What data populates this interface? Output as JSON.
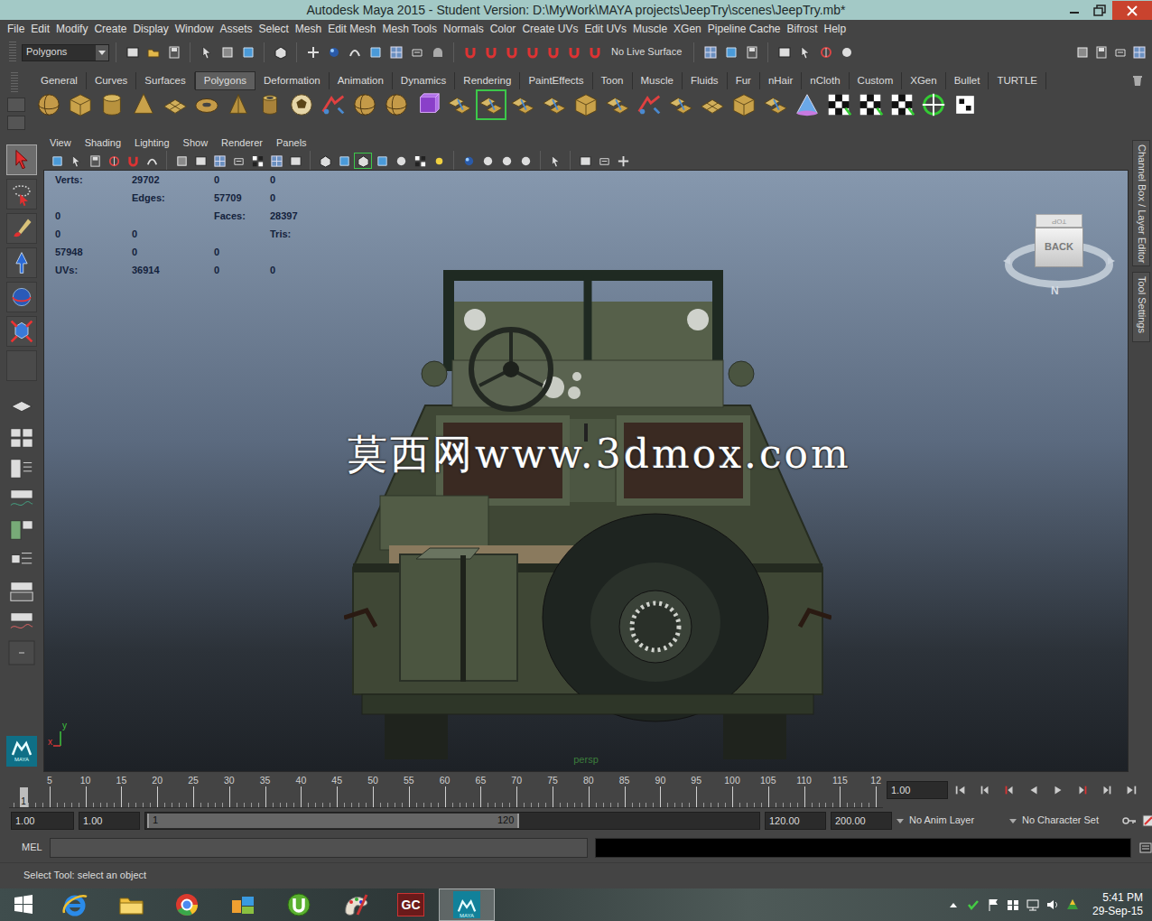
{
  "window": {
    "title": "Autodesk Maya 2015 - Student Version: D:\\MyWork\\MAYA projects\\JeepTry\\scenes\\JeepTry.mb*"
  },
  "menu": [
    "File",
    "Edit",
    "Modify",
    "Create",
    "Display",
    "Window",
    "Assets",
    "Select",
    "Mesh",
    "Edit Mesh",
    "Mesh Tools",
    "Normals",
    "Color",
    "Create UVs",
    "Edit UVs",
    "Muscle",
    "XGen",
    "Pipeline Cache",
    "Bifrost",
    "Help"
  ],
  "status_line": {
    "mode": "Polygons",
    "live_surface": "No Live Surface"
  },
  "shelf": {
    "tabs": [
      {
        "label": "General",
        "selected": false
      },
      {
        "label": "Curves",
        "selected": false
      },
      {
        "label": "Surfaces",
        "selected": false
      },
      {
        "label": "Polygons",
        "selected": true
      },
      {
        "label": "Deformation",
        "selected": false
      },
      {
        "label": "Animation",
        "selected": false
      },
      {
        "label": "Dynamics",
        "selected": false
      },
      {
        "label": "Rendering",
        "selected": false
      },
      {
        "label": "PaintEffects",
        "selected": false
      },
      {
        "label": "Toon",
        "selected": false
      },
      {
        "label": "Muscle",
        "selected": false
      },
      {
        "label": "Fluids",
        "selected": false
      },
      {
        "label": "Fur",
        "selected": false
      },
      {
        "label": "nHair",
        "selected": false
      },
      {
        "label": "nCloth",
        "selected": false
      },
      {
        "label": "Custom",
        "selected": false
      },
      {
        "label": "XGen",
        "selected": false
      },
      {
        "label": "Bullet",
        "selected": false
      },
      {
        "label": "TURTLE",
        "selected": false
      }
    ],
    "icons": [
      {
        "selected": false
      },
      {
        "selected": false
      },
      {
        "selected": false
      },
      {
        "selected": false
      },
      {
        "selected": false
      },
      {
        "selected": false
      },
      {
        "selected": false
      },
      {
        "selected": false
      },
      {
        "selected": false
      },
      {
        "selected": false
      },
      {
        "selected": false
      },
      {
        "selected": false
      },
      {
        "selected": false
      },
      {
        "selected": false
      },
      {
        "selected": true
      },
      {
        "selected": false
      },
      {
        "selected": false
      },
      {
        "selected": false
      },
      {
        "selected": false
      },
      {
        "selected": false
      },
      {
        "selected": false
      },
      {
        "selected": false
      },
      {
        "selected": false
      },
      {
        "selected": false
      },
      {
        "selected": false
      },
      {
        "selected": false
      },
      {
        "selected": false
      },
      {
        "selected": false
      },
      {
        "selected": false
      },
      {
        "selected": false
      }
    ]
  },
  "toolbox": {
    "tools": [
      {
        "selected": true
      },
      {
        "selected": false
      },
      {
        "selected": false
      },
      {
        "selected": false
      },
      {
        "selected": false
      },
      {
        "selected": false
      },
      {
        "selected": false
      }
    ],
    "logo": "MAYA"
  },
  "panel": {
    "menu": [
      "View",
      "Shading",
      "Lighting",
      "Show",
      "Renderer",
      "Panels"
    ],
    "toolbar": [
      {
        "selected": false
      },
      {
        "selected": false
      },
      {
        "selected": false
      },
      {
        "selected": false
      },
      {
        "selected": false
      },
      {
        "selected": false
      },
      {
        "selected": false
      },
      {
        "selected": false
      },
      {
        "selected": false
      },
      {
        "selected": false
      },
      {
        "selected": false
      },
      {
        "selected": false
      },
      {
        "selected": false
      },
      {
        "selected": false
      },
      {
        "selected": false
      },
      {
        "selected": true
      },
      {
        "selected": false
      },
      {
        "selected": false
      },
      {
        "selected": false
      },
      {
        "selected": false
      },
      {
        "selected": false
      },
      {
        "selected": false
      },
      {
        "selected": false
      },
      {
        "selected": false
      },
      {
        "selected": false
      },
      {
        "selected": false
      },
      {
        "selected": false
      },
      {
        "selected": false
      }
    ]
  },
  "hud": [
    {
      "label": "Verts:",
      "values": [
        "29702",
        "0",
        "0"
      ]
    },
    {
      "label": "Edges:",
      "values": [
        "57709",
        "0",
        "0"
      ]
    },
    {
      "label": "Faces:",
      "values": [
        "28397",
        "0",
        "0"
      ]
    },
    {
      "label": "Tris:",
      "values": [
        "57948",
        "0",
        "0"
      ]
    },
    {
      "label": "UVs:",
      "values": [
        "36914",
        "0",
        "0"
      ]
    }
  ],
  "viewcube": {
    "top": "TOP",
    "face": "BACK",
    "compass": "N"
  },
  "viewport": {
    "watermark": "莫西网www.3dmox.com",
    "camera": "persp",
    "axes": [
      "y",
      "x"
    ]
  },
  "side_tabs": [
    "Channel Box / Layer Editor",
    "Tool Settings"
  ],
  "time_slider": {
    "ticks": [
      "5",
      "10",
      "15",
      "20",
      "25",
      "30",
      "35",
      "40",
      "45",
      "50",
      "55",
      "60",
      "65",
      "70",
      "75",
      "80",
      "85",
      "90",
      "95",
      "100",
      "105",
      "110",
      "115",
      "12"
    ],
    "current_frame": "1",
    "level": 0.012,
    "current_time": "1.00"
  },
  "range_slider": {
    "start_time": "1.00",
    "playback_start": "1.00",
    "handle_start": "1",
    "handle_end": "120",
    "level": 0.61,
    "playback_end": "120.00",
    "end_time": "200.00",
    "anim_layer": "No Anim Layer",
    "character_set": "No Character Set"
  },
  "command_line": {
    "language": "MEL"
  },
  "help_line": "Select Tool: select an object",
  "taskbar": {
    "apps": [
      {
        "kind": "ie",
        "selected": false
      },
      {
        "kind": "explorer",
        "selected": false
      },
      {
        "kind": "chrome",
        "selected": false
      },
      {
        "kind": "live",
        "selected": false
      },
      {
        "kind": "utorrent",
        "selected": false
      },
      {
        "kind": "paint",
        "selected": false
      },
      {
        "kind": "gc",
        "label": "GC",
        "selected": false
      },
      {
        "kind": "maya",
        "label": "MAYA",
        "selected": true
      }
    ],
    "clock": {
      "time": "5:41 PM",
      "date": "29-Sep-15"
    }
  }
}
